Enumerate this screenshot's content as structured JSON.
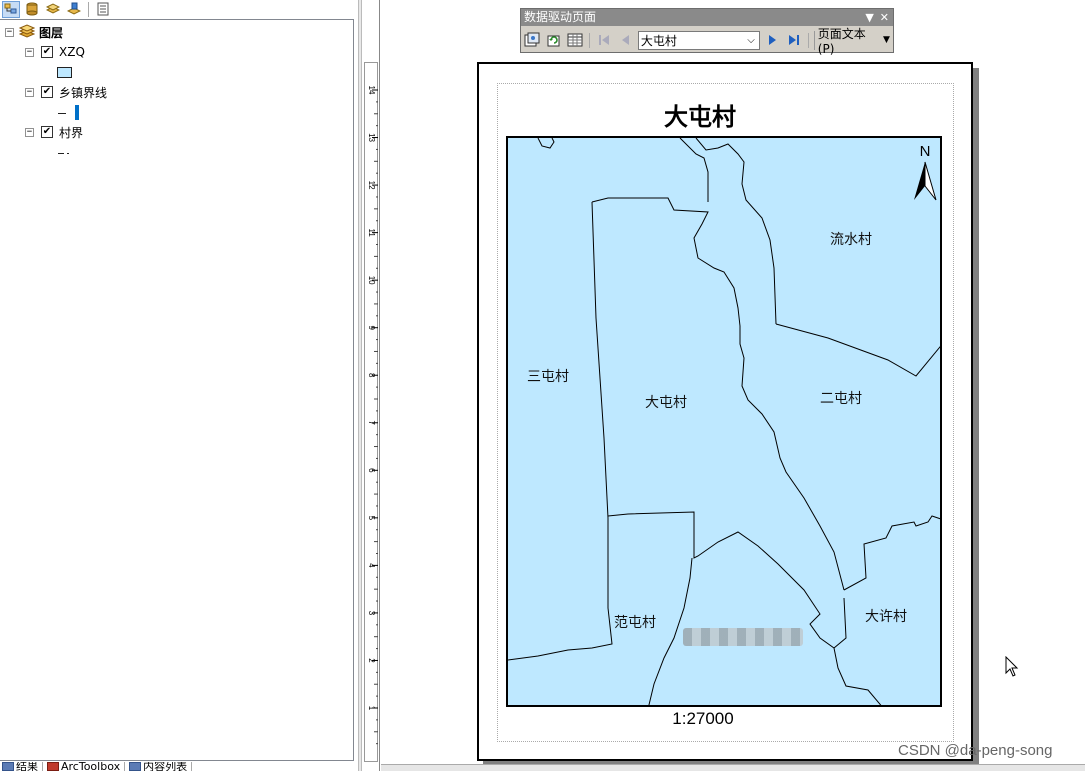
{
  "toc": {
    "root_label": "图层",
    "layers": [
      {
        "name": "XZQ",
        "checked": true
      },
      {
        "name": "乡镇界线",
        "checked": true
      },
      {
        "name": "村界",
        "checked": true
      }
    ],
    "bottom_tabs": [
      "结果",
      "ArcToolbox",
      "内容列表"
    ],
    "toolbar_icons": [
      "list-by-drawing-order-icon",
      "list-by-source-icon",
      "list-by-visibility-icon",
      "list-by-selection-icon",
      "options-icon"
    ]
  },
  "ruler": {
    "ticks": [
      "14",
      "13",
      "12",
      "11",
      "10",
      "9",
      "8",
      "7",
      "6",
      "5",
      "4",
      "3",
      "2",
      "1"
    ]
  },
  "data_driven_pages": {
    "title": "数据驱动页面",
    "current_page": "大屯村",
    "page_text_label": "页面文本(P)"
  },
  "layout": {
    "map_title": "大屯村",
    "north_label": "N",
    "scale_text": "1:27000",
    "villages": [
      "流水村",
      "三屯村",
      "大屯村",
      "二屯村",
      "范屯村",
      "大许村"
    ]
  },
  "colors": {
    "map_fill": "#bee8ff",
    "boundary_line": "#000000",
    "selected_icon_bg": "#c7dcf5",
    "ddp_titlebar": "#8a8a8a"
  },
  "watermark": "CSDN @da-peng-song"
}
